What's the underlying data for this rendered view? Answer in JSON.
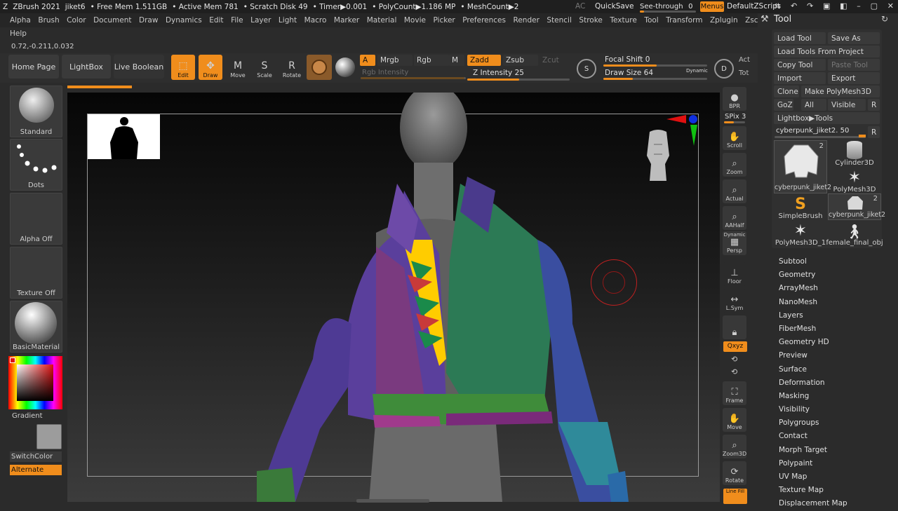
{
  "titlebar": {
    "app": "ZBrush 2021",
    "file": "jiket6",
    "free_mem": "• Free Mem 1.511GB",
    "active_mem": "• Active Mem 781",
    "scratch": "• Scratch Disk 49",
    "timer": "• Timer▶0.001",
    "polycount": "• PolyCount▶1.186 MP",
    "meshcount": "• MeshCount▶2",
    "ac": "AC",
    "quicksave": "QuickSave",
    "seethrough_label": "See-through",
    "seethrough_value": "0",
    "menus": "Menus",
    "script": "DefaultZScript"
  },
  "menubar": [
    "Alpha",
    "Brush",
    "Color",
    "Document",
    "Draw",
    "Dynamics",
    "Edit",
    "File",
    "Layer",
    "Light",
    "Macro",
    "Marker",
    "Material",
    "Movie",
    "Picker",
    "Preferences",
    "Render",
    "Stencil",
    "Stroke",
    "Texture",
    "Tool",
    "Transform",
    "Zplugin",
    "Zscript"
  ],
  "help": "Help",
  "coords": "0.72,-0.211,0.032",
  "shelf": {
    "home": "Home Page",
    "lightbox": "LightBox",
    "liveboolean": "Live Boolean",
    "edit": "Edit",
    "draw": "Draw",
    "move": "Move",
    "scale": "Scale",
    "rotate": "Rotate",
    "a": "A",
    "mrgb": "Mrgb",
    "rgb": "Rgb",
    "m": "M",
    "rgb_intensity": "Rgb Intensity",
    "zadd": "Zadd",
    "zsub": "Zsub",
    "zcut": "Zcut",
    "z_intensity_label": "Z Intensity",
    "z_intensity": "25",
    "focal_label": "Focal Shift",
    "focal": "0",
    "drawsize_label": "Draw Size",
    "drawsize": "64",
    "dynamic": "Dynamic",
    "s": "S",
    "d": "D",
    "act": "Act",
    "tot": "Tot"
  },
  "left": {
    "brush": "Standard",
    "stroke": "Dots",
    "alpha": "Alpha Off",
    "texture": "Texture Off",
    "material": "BasicMaterial",
    "gradient": "Gradient",
    "switchcolor": "SwitchColor",
    "alternate": "Alternate"
  },
  "right_tools": [
    "BPR",
    "SPix 3",
    "Scroll",
    "Zoom",
    "Actual",
    "AAHalf",
    "Persp",
    "Floor",
    "L.Sym",
    "Qxyz",
    "Frame",
    "Move",
    "Zoom3D",
    "Rotate",
    "Line Fill"
  ],
  "right_tool_sub": {
    "persp_top": "Dynamic",
    "spix_value": "3"
  },
  "toolpanel": {
    "title": "Tool",
    "buttons": {
      "load": "Load Tool",
      "saveas": "Save As",
      "loadproj": "Load Tools From Project",
      "copy": "Copy Tool",
      "paste": "Paste Tool",
      "import": "Import",
      "export": "Export",
      "clone": "Clone",
      "makepoly": "Make PolyMesh3D",
      "goz": "GoZ",
      "all": "All",
      "visible": "Visible",
      "r": "R",
      "lightbox_tools": "Lightbox▶Tools",
      "current": "cyberpunk_jiket2. 50",
      "r2": "R"
    },
    "thumbs": [
      {
        "label": "cyberpunk_jiket2",
        "badge": "2"
      },
      {
        "label": "Cylinder3D",
        "badge": ""
      },
      {
        "label": "PolyMesh3D",
        "badge": ""
      },
      {
        "label": "SimpleBrush",
        "badge": ""
      },
      {
        "label": "cyberpunk_jiket2",
        "badge": "2"
      },
      {
        "label": "PolyMesh3D_1",
        "badge": ""
      },
      {
        "label": "female_final_obj",
        "badge": ""
      }
    ],
    "sections": [
      "Subtool",
      "Geometry",
      "ArrayMesh",
      "NanoMesh",
      "Layers",
      "FiberMesh",
      "Geometry HD",
      "Preview",
      "Surface",
      "Deformation",
      "Masking",
      "Visibility",
      "Polygroups",
      "Contact",
      "Morph Target",
      "Polypaint",
      "UV Map",
      "Texture Map",
      "Displacement Map"
    ]
  },
  "colors": {
    "accent": "#f08d1c",
    "panel": "#2b2b2b"
  }
}
